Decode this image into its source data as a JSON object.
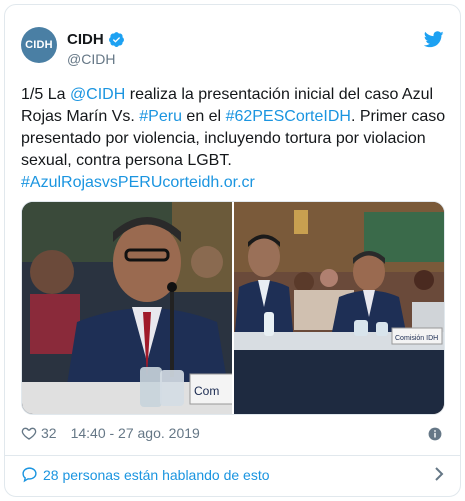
{
  "author": {
    "avatar_text": "CIDH",
    "name": "CIDH",
    "handle": "@CIDH"
  },
  "icons": {
    "verified": "verified-badge-icon",
    "twitter": "twitter-bird-icon",
    "heart": "heart-icon",
    "info": "info-icon",
    "conversation": "speech-bubble-icon",
    "chevron": "chevron-right-icon"
  },
  "tweet": {
    "t1": "1/5 La ",
    "mention": "@CIDH",
    "t2": " realiza la presentación inicial del caso Azul Rojas Marín Vs. ",
    "hashtag_peru": "#Peru",
    "t3": " en el ",
    "hashtag_corte": "#62PESCorteIDH",
    "t4": ". Primer caso presentado por violencia, incluyendo tortura por violacion sexual, contra persona LGBT. ",
    "link": "#AzulRojasvsPERUcorteidh.or.cr"
  },
  "media": {
    "right_nameplate": "Comisión IDH",
    "left_nameplate": "Com"
  },
  "footer": {
    "likes": "32",
    "timestamp": "14:40 - 27 ago. 2019",
    "conversation": "28 personas están hablando de esto"
  },
  "colors": {
    "link": "#1b95e0",
    "avatar": "#4a7fa4",
    "secondary_text": "#657786",
    "border": "#e1e8ed"
  }
}
